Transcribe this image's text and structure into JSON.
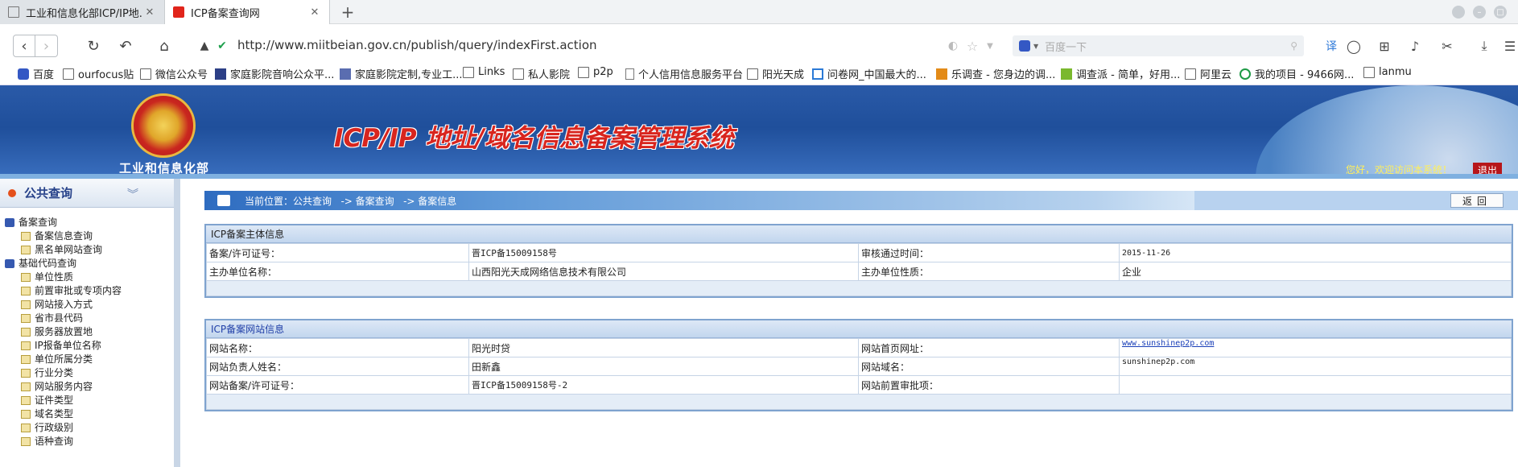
{
  "browser": {
    "tabs": [
      {
        "title": "工业和信息化部ICP/IP地...",
        "active": false
      },
      {
        "title": "ICP备案查询网",
        "active": true
      }
    ],
    "url": "http://www.miitbeian.gov.cn/publish/query/indexFirst.action",
    "search_placeholder": "百度一下",
    "bookmarks": [
      "百度",
      "ourfocus贴",
      "微信公众号",
      "家庭影院音响公众平...",
      "家庭影院定制,专业工...",
      "Links",
      "私人影院",
      "p2p",
      "个人信用信息服务平台",
      "阳光天成",
      "问卷网_中国最大的...",
      "乐调查 - 您身边的调...",
      "调查派 - 简单，好用...",
      "阿里云",
      "我的项目 - 9466网...",
      "lanmu"
    ]
  },
  "header": {
    "dept": "工业和信息化部",
    "title": "ICP/IP 地址/域名信息备案管理系统",
    "welcome": "您好，欢迎访问本系统！",
    "logout": "退出"
  },
  "sidebar": {
    "title": "公共查询",
    "groups": [
      {
        "label": "备案查询",
        "items": [
          "备案信息查询",
          "黑名单网站查询"
        ]
      },
      {
        "label": "基础代码查询",
        "items": [
          "单位性质",
          "前置审批或专项内容",
          "网站接入方式",
          "省市县代码",
          "服务器放置地",
          "IP报备单位名称",
          "单位所属分类",
          "行业分类",
          "网站服务内容",
          "证件类型",
          "域名类型",
          "行政级别",
          "语种查询"
        ]
      }
    ]
  },
  "breadcrumb": {
    "text": "当前位置：公共查询   -> 备案查询   -> 备案信息",
    "back_button": "返回"
  },
  "subject_panel": {
    "title": "ICP备案主体信息",
    "rows": [
      {
        "k1": "备案/许可证号：",
        "v1": "晋ICP备15009158号",
        "k2": "审核通过时间：",
        "v2": "2015-11-26"
      },
      {
        "k1": "主办单位名称：",
        "v1": "山西阳光天成网络信息技术有限公司",
        "k2": "主办单位性质：",
        "v2": "企业"
      }
    ]
  },
  "site_panel": {
    "title": "ICP备案网站信息",
    "rows": [
      {
        "k1": "网站名称：",
        "v1": "阳光时贷",
        "k2": "网站首页网址：",
        "v2": "www.sunshinep2p.com"
      },
      {
        "k1": "网站负责人姓名：",
        "v1": "田新鑫",
        "k2": "网站域名：",
        "v2": "sunshinep2p.com"
      },
      {
        "k1": "网站备案/许可证号：",
        "v1": "晋ICP备15009158号-2",
        "k2": "网站前置审批项：",
        "v2": ""
      }
    ]
  }
}
